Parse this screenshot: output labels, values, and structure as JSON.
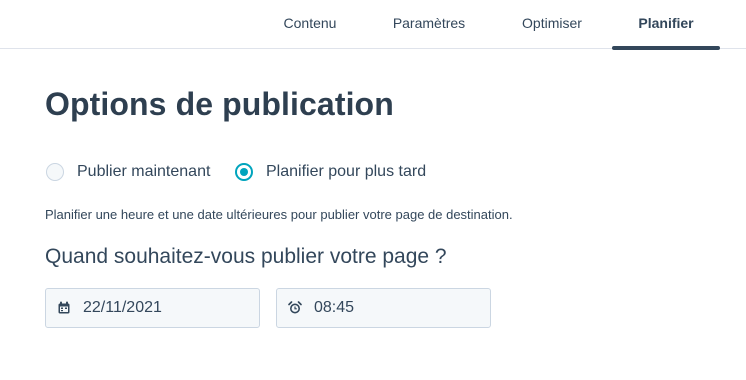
{
  "tabs": [
    {
      "label": "Contenu",
      "active": false
    },
    {
      "label": "Paramètres",
      "active": false
    },
    {
      "label": "Optimiser",
      "active": false
    },
    {
      "label": "Planifier",
      "active": true
    }
  ],
  "publish": {
    "title": "Options de publication",
    "options": [
      {
        "label": "Publier maintenant",
        "selected": false
      },
      {
        "label": "Planifier pour plus tard",
        "selected": true
      }
    ],
    "help_text": "Planifier une heure et une date ultérieures pour publier votre page de destination.",
    "question": "Quand souhaitez-vous publier votre page ?",
    "date": {
      "value": "22/11/2021",
      "icon": "calendar-icon"
    },
    "time": {
      "value": "08:45",
      "icon": "alarm-clock-icon"
    }
  },
  "colors": {
    "text": "#33475b",
    "accent": "#00a4bd",
    "field_bg": "#f5f8fa",
    "border": "#cbd6e2"
  }
}
